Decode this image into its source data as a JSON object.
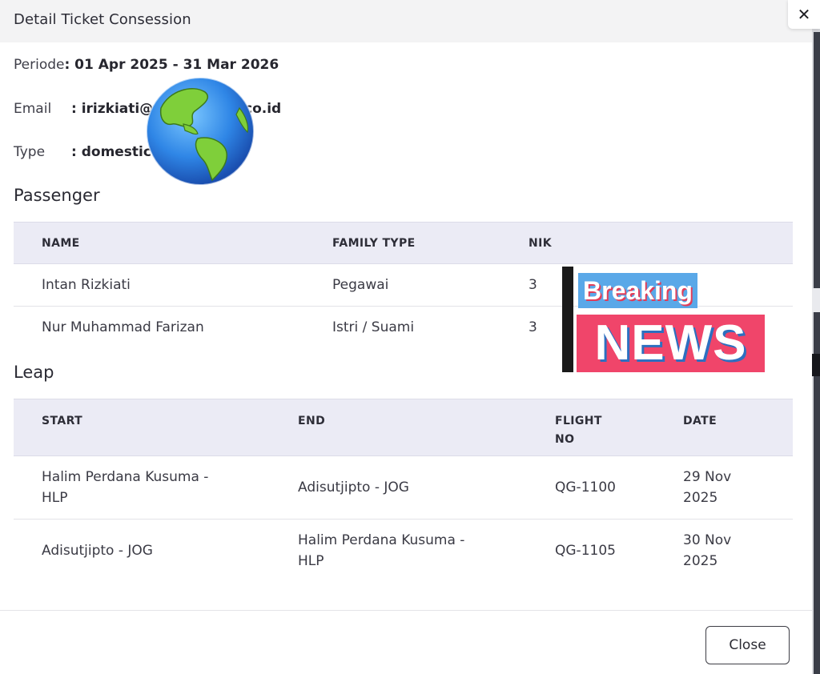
{
  "modal": {
    "title": "Detail Ticket Consession",
    "close_icon_glyph": "✕"
  },
  "info": {
    "periode_label": "Periode",
    "periode_value": ": 01 Apr 2025 - 31 Mar 2026",
    "email_label": "Email",
    "email_value": ": irizkiati@",
    "email_value_tail": "co.id",
    "type_label": "Type",
    "type_value": ": domestic"
  },
  "passenger": {
    "title": "Passenger",
    "headers": [
      "NAME",
      "FAMILY TYPE",
      "NIK"
    ],
    "rows": [
      {
        "name": "Intan Rizkiati",
        "family_type": "Pegawai",
        "nik": "3"
      },
      {
        "name": "Nur Muhammad Farizan",
        "family_type": "Istri / Suami",
        "nik": "3"
      }
    ]
  },
  "leap": {
    "title": "Leap",
    "headers": {
      "start": "START",
      "end": "END",
      "flight_no": "FLIGHT NO",
      "date": "DATE"
    },
    "rows": [
      {
        "start": "Halim Perdana Kusuma - HLP",
        "end": "Adisutjipto - JOG",
        "flight_no": "QG-1100",
        "date": "29 Nov 2025"
      },
      {
        "start": "Adisutjipto - JOG",
        "end": "Halim Perdana Kusuma - HLP",
        "flight_no": "QG-1105",
        "date": "30 Nov 2025"
      }
    ]
  },
  "footer": {
    "close_label": "Close"
  },
  "overlays": {
    "globe_icon": "globe-americas",
    "breaking_label": "Breaking",
    "news_label": "NEWS"
  }
}
